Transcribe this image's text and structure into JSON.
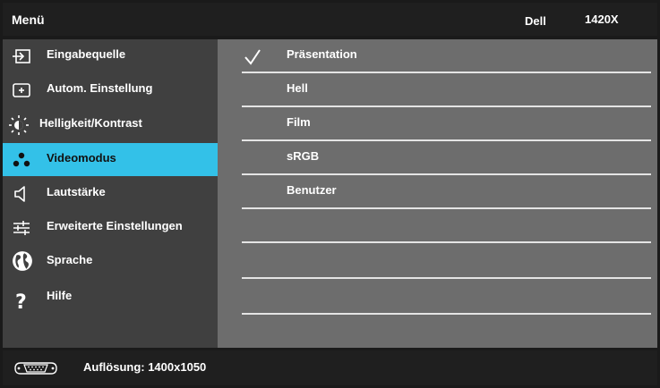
{
  "header": {
    "title": "Menü",
    "brand": "Dell",
    "model": "1420X"
  },
  "sidebar": {
    "items": [
      {
        "label": "Eingabequelle",
        "icon": "input-source-icon"
      },
      {
        "label": "Autom. Einstellung",
        "icon": "auto-adjust-icon"
      },
      {
        "label": "Helligkeit/Kontrast",
        "icon": "brightness-icon"
      },
      {
        "label": "Videomodus",
        "icon": "video-mode-icon",
        "active": true
      },
      {
        "label": "Lautstärke",
        "icon": "volume-icon"
      },
      {
        "label": "Erweiterte Einstellungen",
        "icon": "advanced-settings-icon"
      },
      {
        "label": "Sprache",
        "icon": "language-globe-icon"
      },
      {
        "label": "Hilfe",
        "icon": "help-icon"
      }
    ]
  },
  "panel": {
    "options": [
      {
        "label": "Präsentation",
        "selected": true
      },
      {
        "label": "Hell"
      },
      {
        "label": "Film"
      },
      {
        "label": "sRGB"
      },
      {
        "label": "Benutzer"
      },
      {
        "label": ""
      },
      {
        "label": ""
      },
      {
        "label": ""
      }
    ]
  },
  "footer": {
    "resolution": "Auflösung: 1400x1050",
    "icon": "vga-connector-icon"
  },
  "colors": {
    "accent": "#33c1e8",
    "sidebar": "#404040",
    "panel": "#6d6d6d",
    "bar": "#1f1f1f"
  }
}
